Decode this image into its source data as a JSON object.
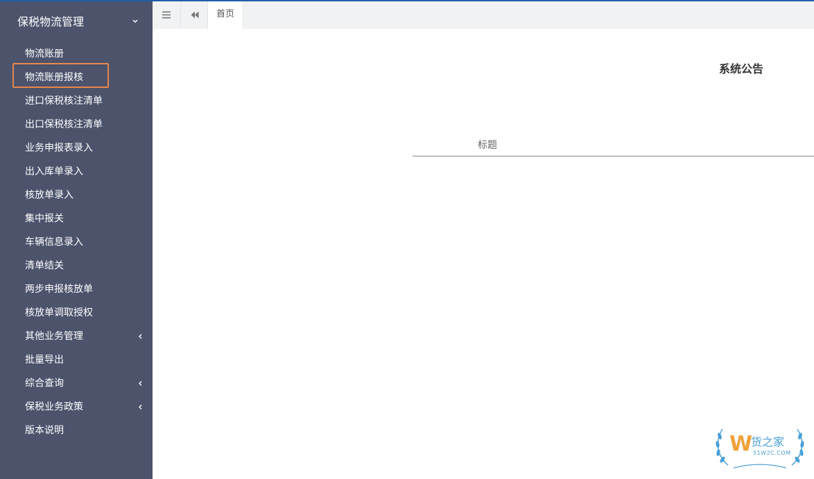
{
  "sidebar": {
    "header": "保税物流管理",
    "items": [
      {
        "label": "物流账册",
        "has_submenu": false
      },
      {
        "label": "物流账册报核",
        "has_submenu": false,
        "highlighted": true
      },
      {
        "label": "进口保税核注清单",
        "has_submenu": false
      },
      {
        "label": "出口保税核注清单",
        "has_submenu": false
      },
      {
        "label": "业务申报表录入",
        "has_submenu": false
      },
      {
        "label": "出入库单录入",
        "has_submenu": false
      },
      {
        "label": "核放单录入",
        "has_submenu": false
      },
      {
        "label": "集中报关",
        "has_submenu": false
      },
      {
        "label": "车辆信息录入",
        "has_submenu": false
      },
      {
        "label": "清单结关",
        "has_submenu": false
      },
      {
        "label": "两步申报核放单",
        "has_submenu": false
      },
      {
        "label": "核放单调取授权",
        "has_submenu": false
      },
      {
        "label": "其他业务管理",
        "has_submenu": true
      },
      {
        "label": "批量导出",
        "has_submenu": false
      },
      {
        "label": "综合查询",
        "has_submenu": true
      },
      {
        "label": "保税业务政策",
        "has_submenu": true
      },
      {
        "label": "版本说明",
        "has_submenu": false
      }
    ]
  },
  "topbar": {
    "menu_icon": "hamburger-icon",
    "back_icon": "double-left-arrow-icon",
    "tab_home": "首页"
  },
  "main": {
    "title": "系统公告",
    "table_columns": [
      "标题"
    ]
  },
  "watermark": {
    "logo_letter": "W",
    "text_cn": "货之家",
    "text_en": "51W2C.COM"
  },
  "colors": {
    "sidebar_bg": "#4c536b",
    "highlight_border": "#e8874a",
    "topbar_bg": "#f1f2f3",
    "top_stripe": "#1f5ea8",
    "watermark": "#4aa0d8"
  }
}
